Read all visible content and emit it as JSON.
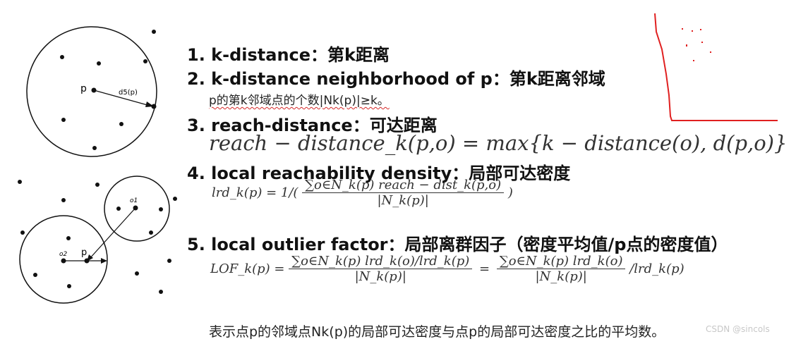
{
  "items": {
    "i1": "1. k-distance：第k距离",
    "i2": "2. k-distance neighborhood of p：第k距离邻域",
    "i2_note": "p的第k邻域点的个数|Nk(p)|≥k。",
    "i3": "3. reach-distance：可达距离",
    "i4": "4. local reachability density：局部可达密度",
    "i5": "5.  local outlier factor：局部离群因子（密度平均值/p点的密度值）"
  },
  "formulas": {
    "reach": "reach − distance_k(p,o) = max{k − distance(o), d(p,o)}",
    "lrd_lhs": "lrd_k(p) = 1/(",
    "lrd_num": "∑o∈N_k(p) reach − dist_k(p,o)",
    "lrd_den": "|N_k(p)|",
    "lrd_close": ")",
    "lof_lhs": "LOF_k(p) =",
    "lof_num1": "∑o∈N_k(p) lrd_k(o)/lrd_k(p)",
    "lof_den1": "|N_k(p)|",
    "lof_eq": "=",
    "lof_num2": "∑o∈N_k(p) lrd_k(o)",
    "lof_den2": "|N_k(p)|",
    "lof_tail": "/lrd_k(p)"
  },
  "footer": "表示点p的邻域点Nk(p)的局部可达密度与点p的局部可达密度之比的平均数。",
  "diagram_top": {
    "p_label": "p",
    "d_label": "d5(p)"
  },
  "diagram_bottom": {
    "o1_label": "o1",
    "o2_label": "o2",
    "p_label": "p"
  },
  "watermark": "CSDN @sincols",
  "colors": {
    "red_line": "#e02020",
    "text": "#111111",
    "math": "#333333"
  }
}
